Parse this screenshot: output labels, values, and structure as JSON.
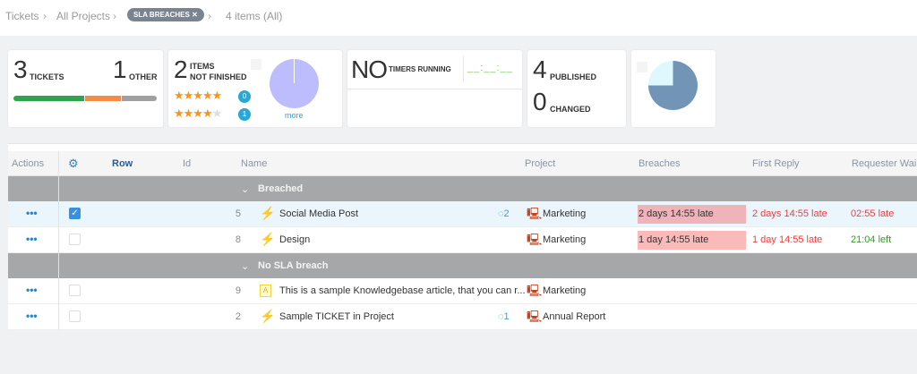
{
  "breadcrumb": {
    "items": [
      "Tickets",
      "All Projects"
    ],
    "filter_pill": "SLA BREACHES",
    "count": "4 items (All)"
  },
  "cards": {
    "tickets": {
      "count": "3",
      "label": "TICKETS",
      "other_count": "1",
      "other_label": "OTHER",
      "progress": [
        {
          "color": "#2ea44f",
          "fraction": 0.5
        },
        {
          "color": "#f58b45",
          "fraction": 0.25
        },
        {
          "color": "#a0a0a0",
          "fraction": 0.25
        }
      ]
    },
    "items": {
      "count": "2",
      "label1": "ITEMS",
      "label2": "NOT FINISHED",
      "rating5_count": "0",
      "rating4_count": "1",
      "more": "more"
    },
    "timers": {
      "big": "NO",
      "label": "TIMERS RUNNING",
      "clock": "__:__:__"
    },
    "published": {
      "count": "4",
      "label": "PUBLISHED",
      "changed_count": "0",
      "changed_label": "CHANGED"
    }
  },
  "table": {
    "headers": {
      "actions": "Actions",
      "row": "Row",
      "id": "Id",
      "name": "Name",
      "project": "Project",
      "breaches": "Breaches",
      "first_reply": "First Reply",
      "requester_wait": "Requester Wai"
    },
    "groups": [
      {
        "label": "Breached",
        "rows": [
          {
            "id": "5",
            "name": "Social Media Post",
            "comments": "2",
            "project": "Marketing",
            "breaches": "2 days 14:55 late",
            "first_reply": "2 days 14:55 late",
            "requester_wait": "02:55 late",
            "checked": true
          },
          {
            "id": "8",
            "name": "Design",
            "project": "Marketing",
            "breaches": "1 day 14:55 late",
            "first_reply": "1 day 14:55 late",
            "requester_wait": "21:04 left"
          }
        ]
      },
      {
        "label": "No SLA breach",
        "rows": [
          {
            "id": "9",
            "name": "This is a sample Knowledgebase article, that you can r...",
            "project": "Marketing"
          },
          {
            "id": "2",
            "name": "Sample TICKET in Project",
            "comments": "1",
            "project": "Annual Report"
          }
        ]
      }
    ]
  }
}
